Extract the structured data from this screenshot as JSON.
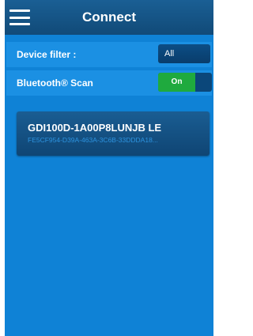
{
  "header": {
    "title": "Connect",
    "menu_icon": "hamburger-icon"
  },
  "settings": {
    "device_filter": {
      "label": "Device filter :",
      "value": "All"
    },
    "bluetooth_scan": {
      "label": "Bluetooth® Scan",
      "toggle_label": "On",
      "state": "on"
    }
  },
  "devices": [
    {
      "name": "GDI100D-1A00P8LUNJB LE",
      "id": "FE5CF954-D39A-463A-3C6B-33DDDA18..."
    }
  ],
  "colors": {
    "background": "#0f82d6",
    "header": "#114a78",
    "row": "#1b90e3",
    "toggle_on": "#1faa3e",
    "card": "#0f4574"
  }
}
